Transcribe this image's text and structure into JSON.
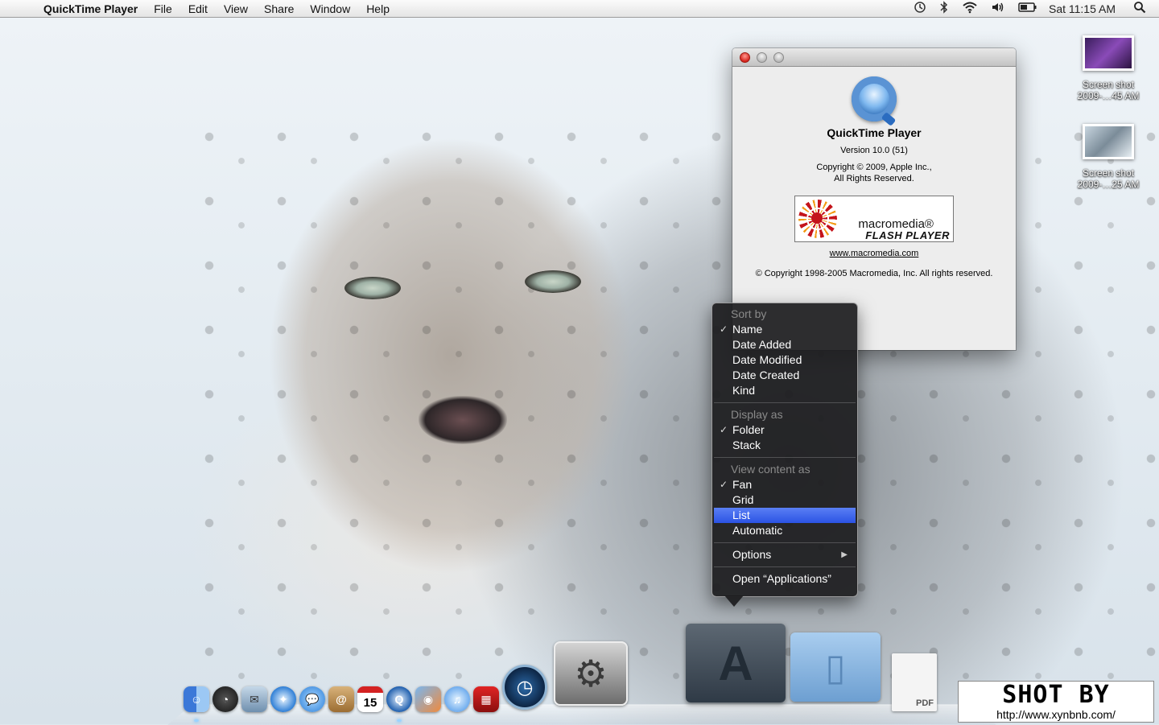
{
  "menubar": {
    "app_name": "QuickTime Player",
    "menus": [
      "File",
      "Edit",
      "View",
      "Share",
      "Window",
      "Help"
    ],
    "clock": "Sat 11:15 AM",
    "status_icons": [
      "time-machine-icon",
      "bluetooth-icon",
      "wifi-icon",
      "volume-icon",
      "battery-icon",
      "spotlight-icon"
    ]
  },
  "desktop_icons": [
    {
      "label": "Screen shot\n2009-…45 AM"
    },
    {
      "label": "Screen shot\n2009-…25 AM"
    }
  ],
  "about_window": {
    "app_title": "QuickTime Player",
    "version": "Version 10.0 (51)",
    "copyright": "Copyright © 2009, Apple Inc.,\nAll Rights Reserved.",
    "flash_brand": "macromedia®",
    "flash_product": "FLASH PLAYER",
    "link": "www.macromedia.com",
    "flash_copyright": "© Copyright 1998-2005 Macromedia, Inc. All rights reserved."
  },
  "context_menu": {
    "sort_header": "Sort by",
    "sort_items": [
      "Name",
      "Date Added",
      "Date Modified",
      "Date Created",
      "Kind"
    ],
    "display_header": "Display as",
    "display_items": [
      "Folder",
      "Stack"
    ],
    "view_header": "View content as",
    "view_items": [
      "Fan",
      "Grid",
      "List",
      "Automatic"
    ],
    "options": "Options",
    "open": "Open “Applications”"
  },
  "dock": {
    "items": [
      "finder-icon",
      "dashboard-icon",
      "mail-icon",
      "safari-icon",
      "ichat-icon",
      "address-book-icon",
      "ical-icon",
      "quicktime-icon",
      "iphoto-icon",
      "itunes-icon",
      "photo-booth-icon",
      "time-machine-icon",
      "system-preferences-icon",
      "applications-stack-icon",
      "documents-stack-icon",
      "pdf-document-icon"
    ],
    "ical_day": "15",
    "pdf_label": "PDF"
  },
  "watermark": {
    "title": "SHOT BY",
    "url": "http://www.xynbnb.com/"
  }
}
